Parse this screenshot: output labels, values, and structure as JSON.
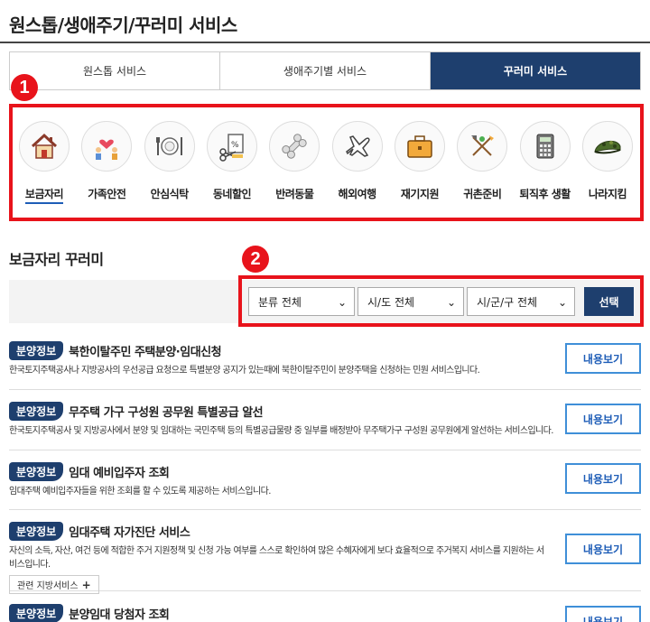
{
  "page": {
    "title": "원스톱/생애주기/꾸러미 서비스"
  },
  "tabs": [
    {
      "label": "원스톱 서비스"
    },
    {
      "label": "생애주기별 서비스"
    },
    {
      "label": "꾸러미 서비스"
    }
  ],
  "markers": {
    "one": "1",
    "two": "2"
  },
  "categories": [
    {
      "label": "보금자리",
      "icon": "house-icon"
    },
    {
      "label": "가족안전",
      "icon": "family-heart-icon"
    },
    {
      "label": "안심식탁",
      "icon": "dining-icon"
    },
    {
      "label": "동네할인",
      "icon": "discount-icon"
    },
    {
      "label": "반려동물",
      "icon": "bone-icon"
    },
    {
      "label": "해외여행",
      "icon": "airplane-icon"
    },
    {
      "label": "재기지원",
      "icon": "briefcase-icon"
    },
    {
      "label": "귀촌준비",
      "icon": "farm-tools-icon"
    },
    {
      "label": "퇴직후 생활",
      "icon": "calculator-icon"
    },
    {
      "label": "나라지킴",
      "icon": "military-cap-icon"
    }
  ],
  "section": {
    "title": "보금자리 꾸러미"
  },
  "filters": {
    "category": "분류 전체",
    "sido": "시/도 전체",
    "sigungu": "시/군/구 전체",
    "submit_label": "선택"
  },
  "services": [
    {
      "badge": "분양정보",
      "title": "북한이탈주민 주택분양·임대신청",
      "desc": "한국토지주택공사나 지방공사의 우선공급 요청으로 특별분양 공지가 있는때에 북한이탈주민이 분양주택을 신청하는 민원 서비스입니다.",
      "button": "내용보기"
    },
    {
      "badge": "분양정보",
      "title": "무주택 가구 구성원 공무원 특별공급 알선",
      "desc": "한국토지주택공사 및 지방공사에서 분양 및 임대하는 국민주택 등의 특별공급물량 중 일부를 배정받아 무주택가구 구성원 공무원에게 알선하는 서비스입니다.",
      "button": "내용보기"
    },
    {
      "badge": "분양정보",
      "title": "임대 예비입주자 조회",
      "desc": "임대주택 예비입주자들을 위한 조회를 할 수 있도록 제공하는 서비스입니다.",
      "button": "내용보기"
    },
    {
      "badge": "분양정보",
      "title": "임대주택 자가진단 서비스",
      "desc": "자신의 소득, 자산, 여건 등에 적합한 주거 지원정책 및 신청 가능 여부를 스스로 확인하여 많은 수혜자에게 보다 효율적으로 주거복지 서비스를 지원하는 서비스입니다.",
      "button": "내용보기",
      "related": "관련 지방서비스"
    },
    {
      "badge": "분양정보",
      "title": "분양임대 당첨자 조회",
      "desc": "",
      "button": "내용보기"
    }
  ],
  "colors": {
    "accent": "#1e3f6e",
    "highlight": "#e8131b",
    "link": "#1e5db7"
  }
}
